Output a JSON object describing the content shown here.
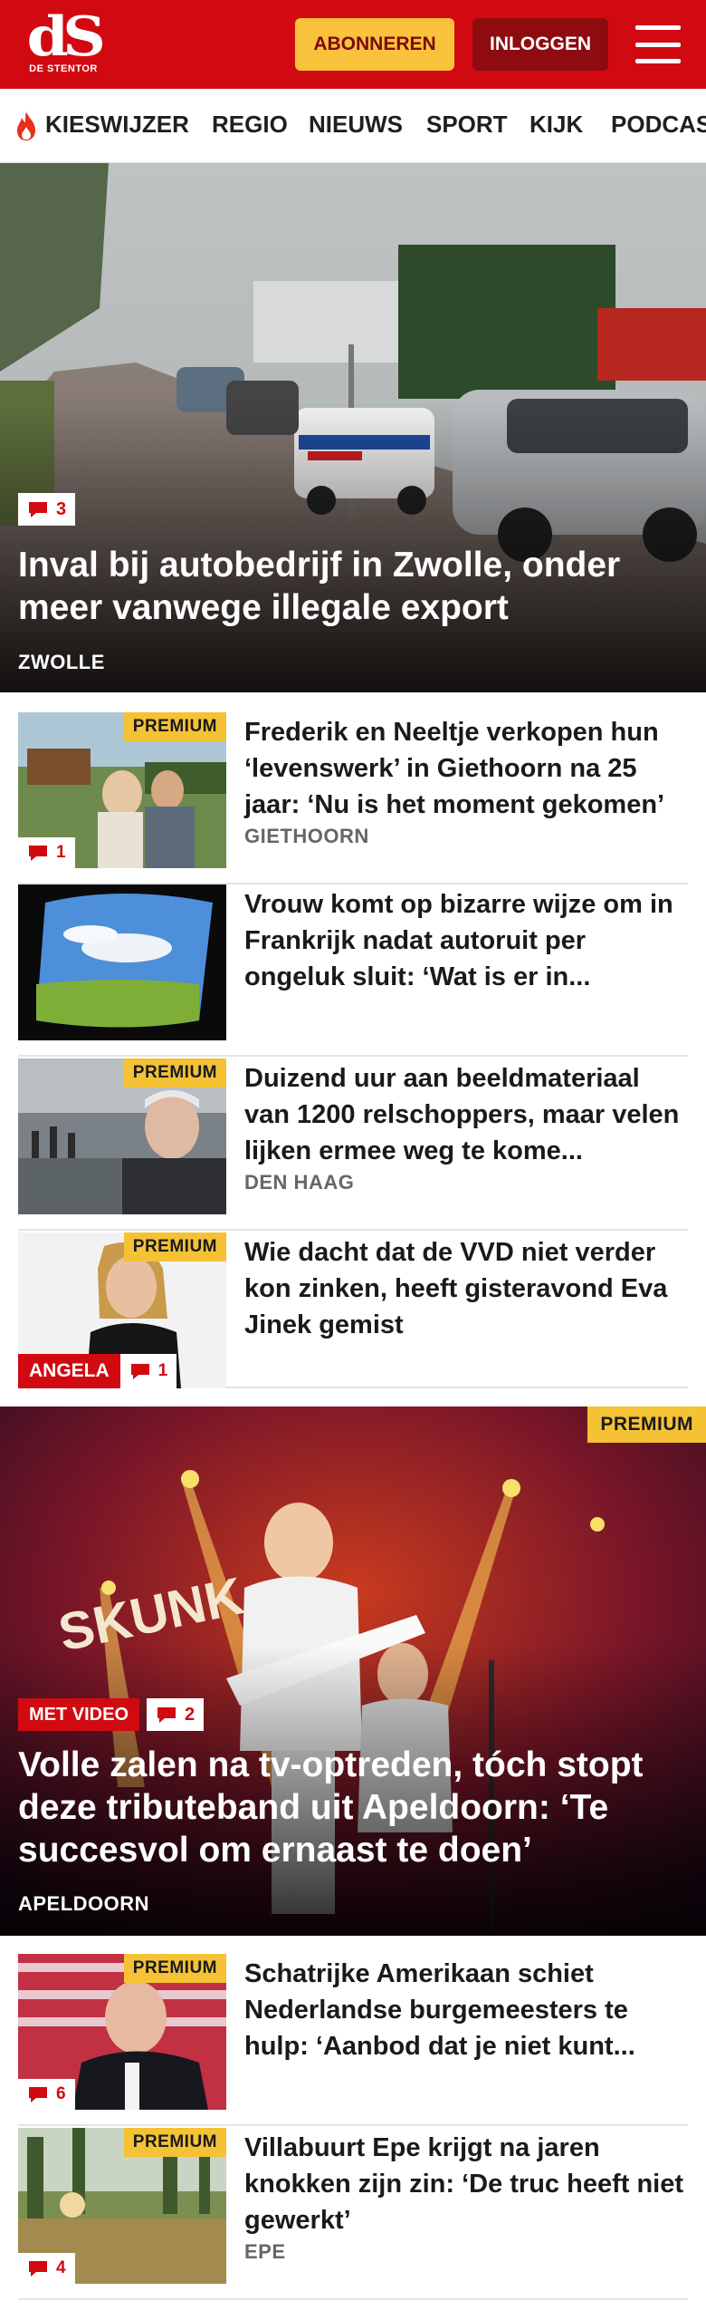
{
  "header": {
    "logo_mark": "dS",
    "logo_sub": "DE STENTOR",
    "subscribe_label": "ABONNEREN",
    "login_label": "INLOGGEN"
  },
  "nav": {
    "items": [
      "KIESWIJZER",
      "REGIO",
      "NIEUWS",
      "SPORT",
      "KIJK",
      "PODCAS"
    ]
  },
  "hero1": {
    "comments": "3",
    "title": "Inval bij autobedrijf in Zwolle, onder meer vanwege illegale export",
    "location": "ZWOLLE"
  },
  "list1": [
    {
      "premium": "PREMIUM",
      "title": "Frederik en Neeltje verkopen hun ‘levenswerk’ in Giethoorn na 25 jaar: ‘Nu is het moment gekomen’",
      "location": "GIETHOORN",
      "comments": "1"
    },
    {
      "premium": "",
      "title": "Vrouw komt op bizarre wijze om in Frankrijk nadat autoruit per ongeluk sluit: ‘Wat is er in...",
      "location": "",
      "comments": ""
    },
    {
      "premium": "PREMIUM",
      "title": "Duizend uur aan beeldmateriaal van 1200 relschoppers, maar velen lijken ermee weg te kome...",
      "location": "DEN HAAG",
      "comments": ""
    },
    {
      "premium": "PREMIUM",
      "title": "Wie dacht dat de VVD niet verder kon zinken, heeft gisteravond Eva Jinek gemist",
      "location": "",
      "comments": "1",
      "tag": "ANGELA"
    }
  ],
  "hero2": {
    "premium": "PREMIUM",
    "video_label": "MET VIDEO",
    "comments": "2",
    "title": "Volle zalen na tv-optreden, tóch stopt deze tributeband uit Apeldoorn: ‘Te succesvol om ernaast te doen’",
    "location": "APELDOORN",
    "stage_text": "SKUNK"
  },
  "list2": [
    {
      "premium": "PREMIUM",
      "title": "Schatrijke Amerikaan schiet Nederlandse burgemeesters te hulp: ‘Aanbod dat je niet kunt...",
      "location": "",
      "comments": "6"
    },
    {
      "premium": "PREMIUM",
      "title": "Villabuurt Epe krijgt na jaren knokken zijn zin: ‘De truc heeft niet gewerkt’",
      "location": "EPE",
      "comments": "4"
    }
  ],
  "colors": {
    "brand_red": "#d10a11",
    "premium_yellow": "#f4c234",
    "subscribe_yellow": "#f9c23c",
    "login_dark_red": "#8e0b10"
  }
}
